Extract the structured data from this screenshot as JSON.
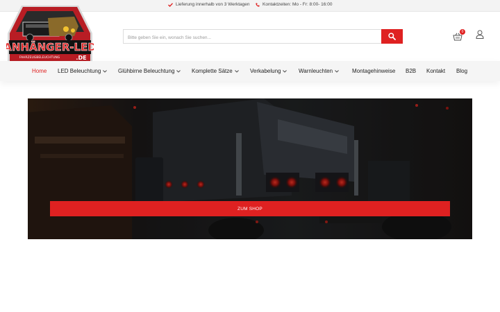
{
  "topbar": {
    "delivery_text": "Lieferung innerhalb von 3 Werktagen",
    "contact_text": "Kontaktzeiten: Mo - Fr: 8:00- 16:00"
  },
  "logo": {
    "brand_text": "ANHÄNGER-LED",
    "sub_text": "FAHRZEUGBELEUCHTUNG",
    "domain_text": ".DE"
  },
  "search": {
    "placeholder": "Bitte geben Sie ein, wonach Sie suchen..."
  },
  "cart": {
    "count": "0"
  },
  "nav": {
    "items": [
      {
        "label": "Home"
      },
      {
        "label": "LED Beleuchtung"
      },
      {
        "label": "Glühbirne Beleuchtung"
      },
      {
        "label": "Komplette Sätze"
      },
      {
        "label": "Verkabelung"
      },
      {
        "label": "Warnleuchten"
      },
      {
        "label": "Montagehinweise"
      },
      {
        "label": "B2B"
      },
      {
        "label": "Kontakt"
      },
      {
        "label": "Blog"
      }
    ]
  },
  "hero": {
    "button_label": "ZUM SHOP"
  },
  "colors": {
    "accent": "#df2121",
    "nav_bg": "#f5f5f5",
    "topbar_bg": "#f3f3f3"
  }
}
